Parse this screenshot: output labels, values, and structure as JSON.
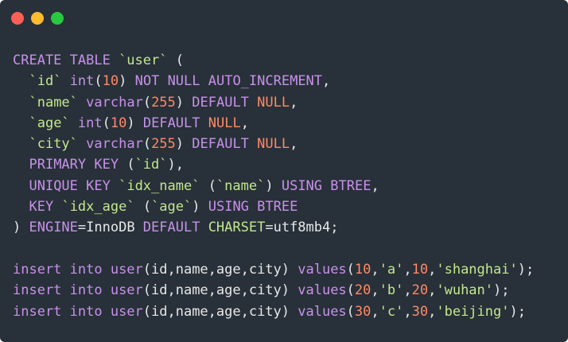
{
  "window": {
    "controls": [
      {
        "name": "close-dot",
        "color": "#fd5f57"
      },
      {
        "name": "minimize-dot",
        "color": "#febc2e"
      },
      {
        "name": "zoom-dot",
        "color": "#28c840"
      }
    ]
  },
  "colors": {
    "background": "#283039",
    "kw": "#c792ea",
    "name": "#c3e88d",
    "num": "#ff8a65",
    "str": "#c3e88d",
    "fn": "#c792ea",
    "plain": "#e8e8e8",
    "punct": "#e8e8e8"
  },
  "code_lines": [
    [
      [
        "kw",
        "CREATE TABLE "
      ],
      [
        "name",
        "`user`"
      ],
      [
        "plain",
        " ("
      ]
    ],
    [
      [
        "plain",
        "  "
      ],
      [
        "name",
        "`id`"
      ],
      [
        "plain",
        " "
      ],
      [
        "kw",
        "int"
      ],
      [
        "plain",
        "("
      ],
      [
        "num",
        "10"
      ],
      [
        "plain",
        ") "
      ],
      [
        "kw",
        "NOT NULL AUTO_INCREMENT"
      ],
      [
        "plain",
        ","
      ]
    ],
    [
      [
        "plain",
        "  "
      ],
      [
        "name",
        "`name`"
      ],
      [
        "plain",
        " "
      ],
      [
        "kw",
        "varchar"
      ],
      [
        "plain",
        "("
      ],
      [
        "num",
        "255"
      ],
      [
        "plain",
        ") "
      ],
      [
        "kw",
        "DEFAULT "
      ],
      [
        "num",
        "NULL"
      ],
      [
        "plain",
        ","
      ]
    ],
    [
      [
        "plain",
        "  "
      ],
      [
        "name",
        "`age`"
      ],
      [
        "plain",
        " "
      ],
      [
        "kw",
        "int"
      ],
      [
        "plain",
        "("
      ],
      [
        "num",
        "10"
      ],
      [
        "plain",
        ") "
      ],
      [
        "kw",
        "DEFAULT "
      ],
      [
        "num",
        "NULL"
      ],
      [
        "plain",
        ","
      ]
    ],
    [
      [
        "plain",
        "  "
      ],
      [
        "name",
        "`city`"
      ],
      [
        "plain",
        " "
      ],
      [
        "kw",
        "varchar"
      ],
      [
        "plain",
        "("
      ],
      [
        "num",
        "255"
      ],
      [
        "plain",
        ") "
      ],
      [
        "kw",
        "DEFAULT "
      ],
      [
        "num",
        "NULL"
      ],
      [
        "plain",
        ","
      ]
    ],
    [
      [
        "plain",
        "  "
      ],
      [
        "kw",
        "PRIMARY KEY"
      ],
      [
        "plain",
        " ("
      ],
      [
        "name",
        "`id`"
      ],
      [
        "plain",
        "),"
      ]
    ],
    [
      [
        "plain",
        "  "
      ],
      [
        "kw",
        "UNIQUE KEY"
      ],
      [
        "plain",
        " "
      ],
      [
        "name",
        "`idx_name`"
      ],
      [
        "plain",
        " ("
      ],
      [
        "name",
        "`name`"
      ],
      [
        "plain",
        ") "
      ],
      [
        "kw",
        "USING BTREE"
      ],
      [
        "plain",
        ","
      ]
    ],
    [
      [
        "plain",
        "  "
      ],
      [
        "kw",
        "KEY"
      ],
      [
        "plain",
        " "
      ],
      [
        "name",
        "`idx_age`"
      ],
      [
        "plain",
        " ("
      ],
      [
        "name",
        "`age`"
      ],
      [
        "plain",
        ") "
      ],
      [
        "kw",
        "USING BTREE"
      ]
    ],
    [
      [
        "plain",
        ") "
      ],
      [
        "kw",
        "ENGINE"
      ],
      [
        "plain",
        "=InnoDB "
      ],
      [
        "kw",
        "DEFAULT "
      ],
      [
        "name",
        "CHARSET"
      ],
      [
        "plain",
        "=utf8mb4;"
      ]
    ],
    [],
    [
      [
        "kw",
        "insert into "
      ],
      [
        "fn",
        "user"
      ],
      [
        "plain",
        "(id,name,age,city) "
      ],
      [
        "kw",
        "values"
      ],
      [
        "plain",
        "("
      ],
      [
        "num",
        "10"
      ],
      [
        "plain",
        ","
      ],
      [
        "str",
        "'a'"
      ],
      [
        "plain",
        ","
      ],
      [
        "num",
        "10"
      ],
      [
        "plain",
        ","
      ],
      [
        "str",
        "'shanghai'"
      ],
      [
        "plain",
        ");"
      ]
    ],
    [
      [
        "kw",
        "insert into "
      ],
      [
        "fn",
        "user"
      ],
      [
        "plain",
        "(id,name,age,city) "
      ],
      [
        "kw",
        "values"
      ],
      [
        "plain",
        "("
      ],
      [
        "num",
        "20"
      ],
      [
        "plain",
        ","
      ],
      [
        "str",
        "'b'"
      ],
      [
        "plain",
        ","
      ],
      [
        "num",
        "20"
      ],
      [
        "plain",
        ","
      ],
      [
        "str",
        "'wuhan'"
      ],
      [
        "plain",
        ");"
      ]
    ],
    [
      [
        "kw",
        "insert into "
      ],
      [
        "fn",
        "user"
      ],
      [
        "plain",
        "(id,name,age,city) "
      ],
      [
        "kw",
        "values"
      ],
      [
        "plain",
        "("
      ],
      [
        "num",
        "30"
      ],
      [
        "plain",
        ","
      ],
      [
        "str",
        "'c'"
      ],
      [
        "plain",
        ","
      ],
      [
        "num",
        "30"
      ],
      [
        "plain",
        ","
      ],
      [
        "str",
        "'beijing'"
      ],
      [
        "plain",
        ");"
      ]
    ]
  ]
}
